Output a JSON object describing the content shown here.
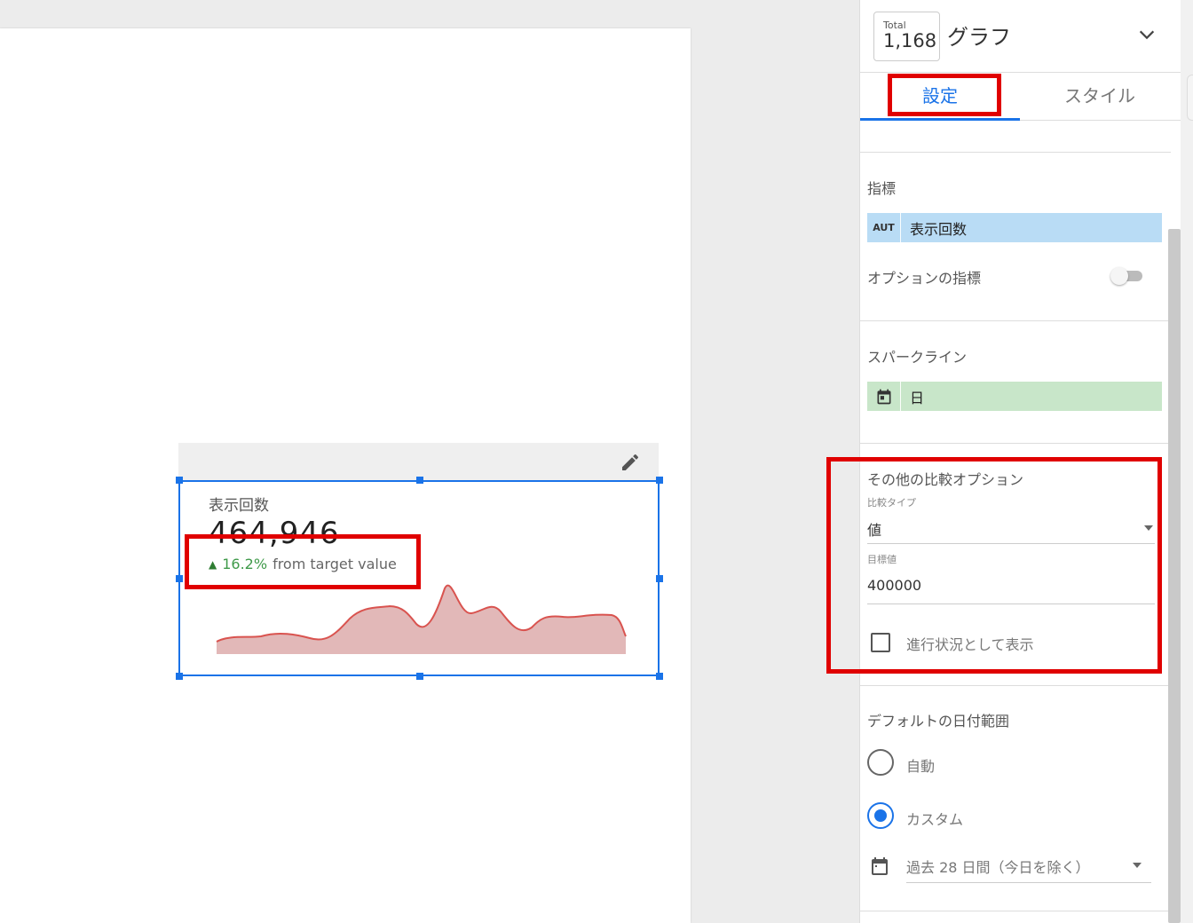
{
  "scorecard": {
    "title": "表示回数",
    "value": "464,946",
    "compare_pct": "16.2%",
    "compare_label": "from target value",
    "arrow": "▲"
  },
  "panel": {
    "total_label": "Total",
    "total_value": "1,168",
    "chart_type": "グラフ",
    "tabs": {
      "setup": "設定",
      "style": "スタイル"
    },
    "metric": {
      "title": "指標",
      "chip_tag": "AUT",
      "chip_value": "表示回数",
      "optional_label": "オプションの指標"
    },
    "sparkline": {
      "title": "スパークライン",
      "chip_value": "日"
    },
    "comparison": {
      "title": "その他の比較オプション",
      "type_label": "比較タイプ",
      "type_value": "値",
      "target_label": "目標値",
      "target_value": "400000",
      "progress_label": "進行状況として表示"
    },
    "date_range": {
      "title": "デフォルトの日付範囲",
      "auto_label": "自動",
      "custom_label": "カスタム",
      "custom_value": "過去 28 日間（今日を除く）"
    }
  },
  "colors": {
    "accent": "#1a73e8",
    "annotation_red": "#e00000",
    "sparkline_fill": "#e2b8b8",
    "sparkline_line": "#d9534f",
    "compare_green": "#3f9a4a"
  }
}
